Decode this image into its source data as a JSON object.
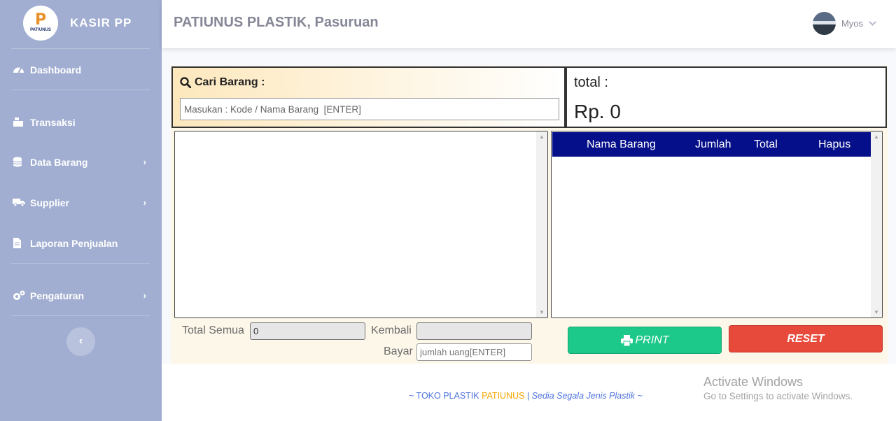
{
  "sidebar": {
    "brand": {
      "logo_text": "P",
      "logo_subtext": "PATIUNUS",
      "name": "KASIR PP"
    },
    "items": [
      {
        "label": "Dashboard",
        "icon": "tachometer-icon"
      },
      {
        "label": "Transaksi",
        "icon": "cash-register-icon"
      },
      {
        "label": "Data Barang",
        "icon": "database-icon",
        "chevron": "›"
      },
      {
        "label": "Supplier",
        "icon": "truck-icon",
        "chevron": "›"
      },
      {
        "label": "Laporan Penjualan",
        "icon": "file-icon"
      },
      {
        "label": "Pengaturan",
        "icon": "cogs-icon",
        "chevron": "›"
      }
    ],
    "toggle": "‹"
  },
  "topbar": {
    "title": "PATIUNUS PLASTIK, Pasuruan",
    "user": {
      "name": "Myos",
      "caret": "⌄"
    }
  },
  "search": {
    "label": "Cari Barang :",
    "placeholder": "Masukan : Kode / Nama Barang  [ENTER]"
  },
  "total": {
    "label": "total :",
    "value": "Rp. 0"
  },
  "cart": {
    "columns": [
      "Nama Barang",
      "Jumlah",
      "Total",
      "Hapus"
    ]
  },
  "payment": {
    "total_semua_label": "Total Semua",
    "total_semua_value": "0",
    "kembali_label": "Kembali",
    "kembali_value": "",
    "bayar_label": "Bayar",
    "bayar_placeholder": "jumlah uang[ENTER]"
  },
  "buttons": {
    "print": "PRINT",
    "reset": "RESET"
  },
  "footer": {
    "prefix": "~ TOKO PLASTIK ",
    "brand": "PATIUNUS",
    "sep": " | ",
    "tagline": "Sedia Segala Jenis Plastik",
    "suffix": " ~"
  },
  "watermark": {
    "title": "Activate Windows",
    "subtitle": "Go to Settings to activate Windows."
  },
  "colors": {
    "sidebar": "#a1aed1",
    "cart_header": "#050f8a",
    "print": "#1cc88a",
    "reset": "#e74a3b"
  }
}
